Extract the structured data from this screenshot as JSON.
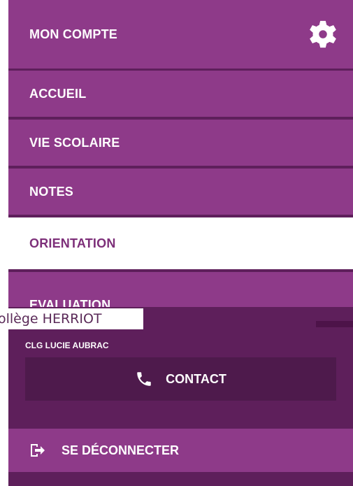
{
  "menu": {
    "account_label": "MON COMPTE",
    "items": [
      {
        "label": "ACCUEIL"
      },
      {
        "label": "VIE SCOLAIRE"
      },
      {
        "label": "NOTES"
      },
      {
        "label": "ORIENTATION",
        "active": true
      },
      {
        "label": "EVALUATION"
      }
    ]
  },
  "school": {
    "tooltip": "ollège HERRIOT",
    "name": "CLG LUCIE AUBRAC"
  },
  "contact": {
    "label": "CONTACT"
  },
  "logout": {
    "label": "SE DÉCONNECTER"
  },
  "colors": {
    "menu_bg": "#8e3a89",
    "active_bg": "#ffffff",
    "active_text": "#7d2f79",
    "dark_panel": "#5e1f5b",
    "contact_bg": "#4e1a4c"
  },
  "icons": {
    "account": "gear-icon",
    "contact": "phone-icon",
    "logout": "logout-icon"
  }
}
